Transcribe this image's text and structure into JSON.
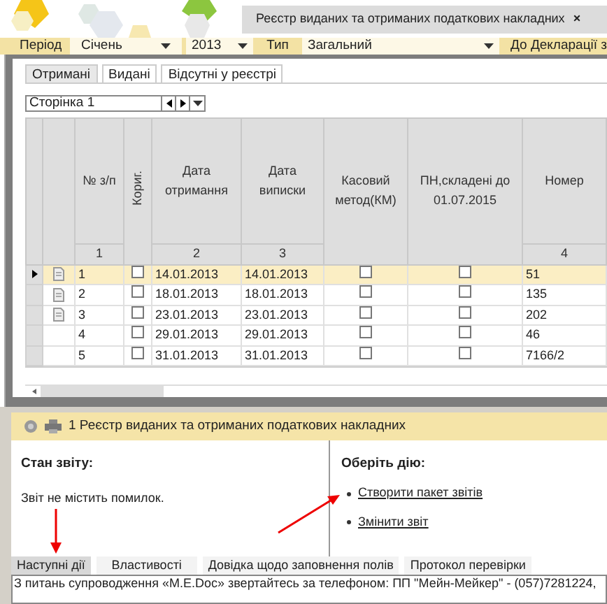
{
  "header_tab": {
    "title": "Реєстр виданих та отриманих податкових накладних",
    "close": "×"
  },
  "filters": {
    "period_label": "Період",
    "period": "Січень",
    "year": "2013",
    "type_label": "Тип",
    "type": "Загальний",
    "declaration_button": "До Декларації з"
  },
  "tabs": [
    {
      "label": "Отримані",
      "selected": true
    },
    {
      "label": "Видані",
      "selected": false
    },
    {
      "label": "Відсутні у реєстрі",
      "selected": false
    }
  ],
  "pager": {
    "value": "Сторінка 1"
  },
  "table": {
    "columns": [
      {
        "label": "№ з/п",
        "number": "1",
        "kind": "normal"
      },
      {
        "label": "Кориг.",
        "kind": "vertical"
      },
      {
        "label": "Дата отримання",
        "number": "2",
        "kind": "normal"
      },
      {
        "label": "Дата виписки",
        "number": "3",
        "kind": "normal"
      },
      {
        "label": "Касовий метод(КМ)",
        "kind": "normal"
      },
      {
        "label": "ПН,складені до 01.07.2015",
        "kind": "normal"
      },
      {
        "label": "Номер",
        "number": "4",
        "kind": "normal"
      }
    ],
    "rows": [
      {
        "selected": true,
        "has_document": true,
        "number": "1",
        "correction": false,
        "received": "14.01.2013",
        "issued": "14.01.2013",
        "cash_method": false,
        "before_2015": false,
        "doc_number": "51"
      },
      {
        "selected": false,
        "has_document": true,
        "number": "2",
        "correction": false,
        "received": "18.01.2013",
        "issued": "18.01.2013",
        "cash_method": false,
        "before_2015": false,
        "doc_number": "135"
      },
      {
        "selected": false,
        "has_document": true,
        "number": "3",
        "correction": false,
        "received": "23.01.2013",
        "issued": "23.01.2013",
        "cash_method": false,
        "before_2015": false,
        "doc_number": "202"
      },
      {
        "selected": false,
        "has_document": false,
        "number": "4",
        "correction": false,
        "received": "29.01.2013",
        "issued": "29.01.2013",
        "cash_method": false,
        "before_2015": false,
        "doc_number": "46"
      },
      {
        "selected": false,
        "has_document": false,
        "number": "5",
        "correction": false,
        "received": "31.01.2013",
        "issued": "31.01.2013",
        "cash_method": false,
        "before_2015": false,
        "doc_number": "7166/2"
      }
    ]
  },
  "report_bar": {
    "title": "1 Реєстр виданих та отриманих податкових накладних"
  },
  "status": {
    "heading": "Стан звіту:",
    "message": "Звіт не містить помилок."
  },
  "actions": {
    "heading": "Оберіть дію:",
    "links": [
      "Створити пакет звітів",
      "Змінити звіт"
    ]
  },
  "bottom_tabs": [
    {
      "label": "Наступні дії",
      "selected": true
    },
    {
      "label": "Властивості",
      "selected": false
    },
    {
      "label": "Довідка щодо заповнення полів",
      "selected": false
    },
    {
      "label": "Протокол перевірки",
      "selected": false
    }
  ],
  "status_bar": "З питань супроводження «M.E.Doc» звертайтесь за телефоном: ПП \"Мейн-Мейкер\" - (057)7281224,"
}
